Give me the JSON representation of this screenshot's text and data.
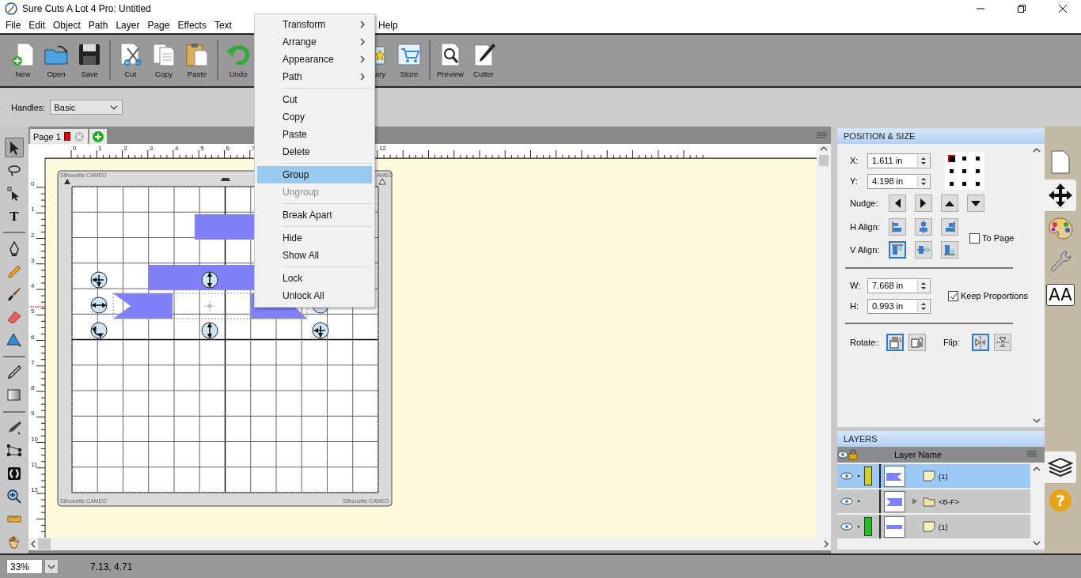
{
  "window": {
    "title": "Sure Cuts A Lot 4 Pro: Untitled"
  },
  "menu_bar": {
    "left": [
      "File",
      "Edit",
      "Object",
      "Path",
      "Layer",
      "Page",
      "Effects",
      "Text"
    ],
    "right": [
      "Help"
    ]
  },
  "toolbar": {
    "groups": [
      [
        {
          "kind": "new",
          "label": "New"
        },
        {
          "kind": "open",
          "label": "Open"
        },
        {
          "kind": "save",
          "label": "Save"
        }
      ],
      [
        {
          "kind": "cut",
          "label": "Cut"
        },
        {
          "kind": "copy",
          "label": "Copy"
        },
        {
          "kind": "paste",
          "label": "Paste"
        }
      ],
      [
        {
          "kind": "undo",
          "label": "Undo"
        }
      ]
    ],
    "after_menu": [
      [
        {
          "kind": "library",
          "label": "ary"
        },
        {
          "kind": "store",
          "label": "Store"
        }
      ],
      [
        {
          "kind": "preview",
          "label": "Preview"
        },
        {
          "kind": "cutter",
          "label": "Cutter"
        }
      ]
    ]
  },
  "options_bar": {
    "label": "Handles:",
    "value": "Basic"
  },
  "tools": [
    [
      {
        "kind": "select",
        "selected": true
      },
      {
        "kind": "lasso",
        "selected": false
      },
      {
        "kind": "node",
        "selected": false
      },
      {
        "kind": "text",
        "glyph": "T",
        "selected": false
      }
    ],
    [
      {
        "kind": "pen",
        "selected": false
      },
      {
        "kind": "pencil",
        "selected": false
      },
      {
        "kind": "brush",
        "selected": false
      },
      {
        "kind": "eraser",
        "selected": false
      },
      {
        "kind": "shape",
        "selected": false
      }
    ],
    [
      {
        "kind": "eyedropper",
        "selected": false
      },
      {
        "kind": "gradient",
        "selected": false
      }
    ],
    [
      {
        "kind": "knife",
        "selected": false
      },
      {
        "kind": "distort",
        "selected": false
      },
      {
        "kind": "weld",
        "selected": false
      },
      {
        "kind": "zoom",
        "selected": false
      },
      {
        "kind": "measure",
        "selected": false
      },
      {
        "kind": "hand",
        "selected": false
      }
    ]
  ],
  "page_tabs": [
    {
      "label": "Page 1",
      "selected": true
    }
  ],
  "document": {
    "top_ruler": [
      "0",
      "1",
      "2",
      "3",
      "4",
      "5",
      "6",
      "7"
    ],
    "top_ruler_end": "12",
    "left_ruler": [
      "0",
      "1",
      "2",
      "3",
      "4",
      "5",
      "6",
      "7",
      "8",
      "9",
      "10",
      "11",
      "12"
    ],
    "mat_labels": {
      "top_left": "Silhouette CAMEO",
      "top_right": "AMEO",
      "bottom_left": "Silhouette CAMEO",
      "bottom_right": "Silhouette CAMEO"
    }
  },
  "context_menu": {
    "sections": [
      [
        {
          "label": "Transform",
          "submenu": true,
          "disabled": false,
          "selected": false
        },
        {
          "label": "Arrange",
          "submenu": true,
          "disabled": false,
          "selected": false
        },
        {
          "label": "Appearance",
          "submenu": true,
          "disabled": false,
          "selected": false
        },
        {
          "label": "Path",
          "submenu": true,
          "disabled": false,
          "selected": false
        }
      ],
      [
        {
          "label": "Cut",
          "submenu": false,
          "disabled": false,
          "selected": false
        },
        {
          "label": "Copy",
          "submenu": false,
          "disabled": false,
          "selected": false
        },
        {
          "label": "Paste",
          "submenu": false,
          "disabled": false,
          "selected": false
        },
        {
          "label": "Delete",
          "submenu": false,
          "disabled": false,
          "selected": false
        }
      ],
      [
        {
          "label": "Group",
          "submenu": false,
          "disabled": false,
          "selected": true
        },
        {
          "label": "Ungroup",
          "submenu": false,
          "disabled": true,
          "selected": false
        }
      ],
      [
        {
          "label": "Break Apart",
          "submenu": false,
          "disabled": false,
          "selected": false
        }
      ],
      [
        {
          "label": "Hide",
          "submenu": false,
          "disabled": false,
          "selected": false
        },
        {
          "label": "Show All",
          "submenu": false,
          "disabled": false,
          "selected": false
        }
      ],
      [
        {
          "label": "Lock",
          "submenu": false,
          "disabled": false,
          "selected": false
        },
        {
          "label": "Unlock All",
          "submenu": false,
          "disabled": false,
          "selected": false
        }
      ]
    ]
  },
  "position_size": {
    "title": "POSITION & SIZE",
    "x": {
      "label": "X:",
      "value": "1.611 in"
    },
    "y": {
      "label": "Y:",
      "value": "4.198 in"
    },
    "anchor": [
      {
        "selected": true
      },
      {
        "selected": false
      },
      {
        "selected": false
      },
      {
        "selected": false
      },
      {
        "selected": false
      },
      {
        "selected": false
      },
      {
        "selected": false
      },
      {
        "selected": false
      },
      {
        "selected": false
      }
    ],
    "nudge_label": "Nudge:",
    "h_align": {
      "label": "H Align:",
      "buttons": [
        {
          "kind": "left",
          "selected": false
        },
        {
          "kind": "center",
          "selected": false
        },
        {
          "kind": "right",
          "selected": false
        }
      ]
    },
    "to_page": {
      "label": "To Page",
      "checked": false
    },
    "v_align": {
      "label": "V Align:",
      "buttons": [
        {
          "kind": "top",
          "selected": true
        },
        {
          "kind": "middle",
          "selected": false
        },
        {
          "kind": "bottom",
          "selected": false
        }
      ]
    },
    "w": {
      "label": "W:",
      "value": "7.668 in"
    },
    "h": {
      "label": "H:",
      "value": "0.993 in"
    },
    "keep_proportions": {
      "label": "Keep Proportions",
      "checked": true
    },
    "rotate": {
      "label": "Rotate:",
      "buttons": [
        {
          "kind": "rotate-left",
          "selected": true
        },
        {
          "kind": "rotate-right",
          "selected": false
        }
      ]
    },
    "flip": {
      "label": "Flip:",
      "buttons": [
        {
          "kind": "flip-horizontal",
          "selected": true
        },
        {
          "kind": "flip-vertical",
          "selected": false
        }
      ]
    }
  },
  "layers": {
    "title": "LAYERS",
    "column": "Layer Name",
    "rows": [
      {
        "name": "(1)",
        "color": "#d8d020",
        "thumbnail": {
          "kind": "ribbon-right"
        },
        "kind": "note",
        "expandable": false,
        "selected": true
      },
      {
        "name": "<B-F>",
        "thumbnail": {
          "kind": "ribbon-left"
        },
        "kind": "folder",
        "expandable": true,
        "selected": false
      },
      {
        "name": "(1)",
        "color": "#20c020",
        "thumbnail": {
          "kind": "bar"
        },
        "kind": "note",
        "expandable": false,
        "selected": false
      }
    ]
  },
  "side_tabs": [
    {
      "kind": "page",
      "selected": false
    },
    {
      "kind": "move",
      "selected": true
    },
    {
      "kind": "palette",
      "selected": false
    },
    {
      "kind": "wrench",
      "selected": false
    },
    {
      "kind": "text",
      "glyph": "AA",
      "selected": false
    }
  ],
  "side_tabs_bottom": [
    {
      "kind": "layers",
      "selected": true
    },
    {
      "kind": "help",
      "glyph": "?",
      "selected": false
    }
  ],
  "status_bar": {
    "zoom": "33%",
    "coordinates": "7.13, 4.71"
  }
}
